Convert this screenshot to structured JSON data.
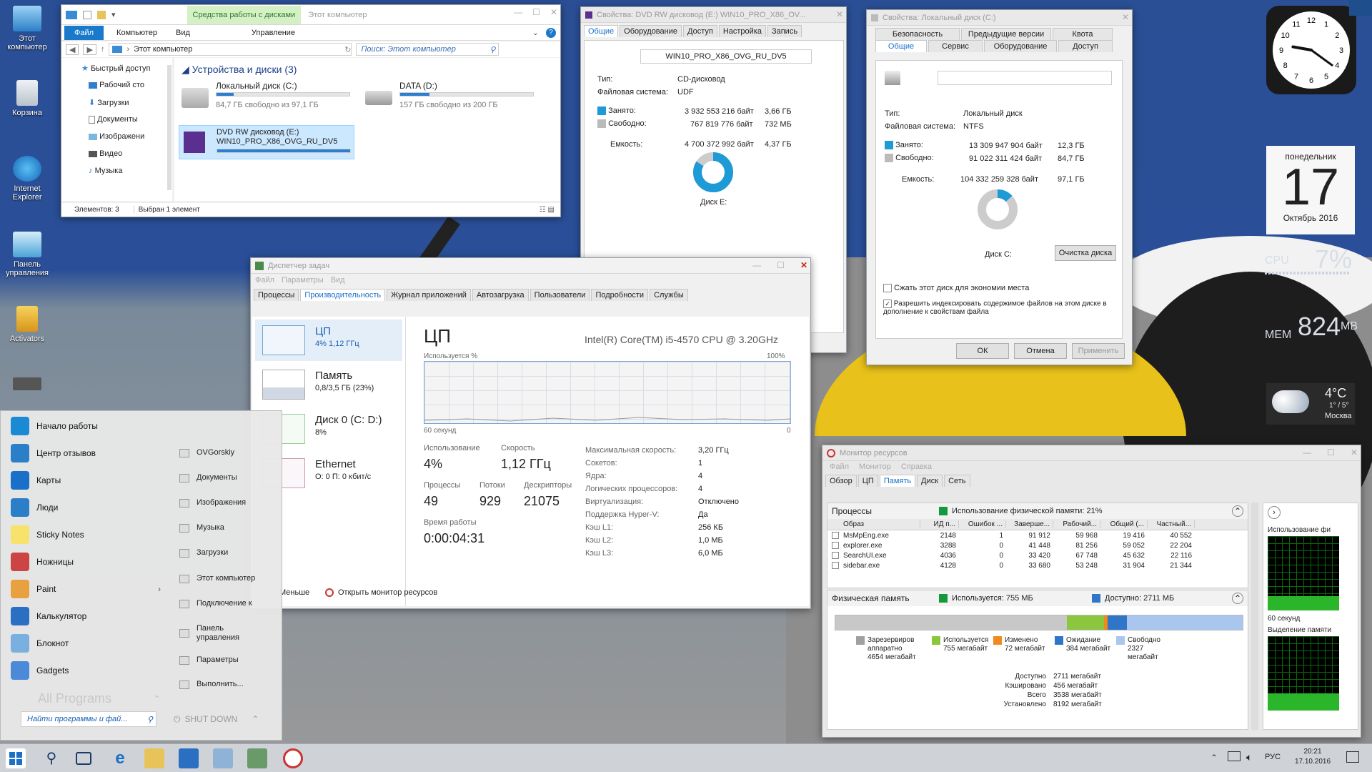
{
  "desktop": {
    "icons": [
      {
        "label": "Этот компьютер"
      },
      {
        "label": "Корзина"
      },
      {
        "label": "Internet Explorer"
      },
      {
        "label": "Панель управления"
      },
      {
        "label": "Activators"
      }
    ]
  },
  "explorer": {
    "context_tab": "Средства работы с дисками",
    "title": "Этот компьютер",
    "ribbon": [
      "Файл",
      "Компьютер",
      "Вид",
      "Управление"
    ],
    "address": "Этот компьютер",
    "search_placeholder": "Поиск: Этот компьютер",
    "group_title": "Устройства и диски (3)",
    "nav": [
      "Быстрый доступ",
      "Рабочий сто",
      "Загрузки",
      "Документы",
      "Изображени",
      "Видео",
      "Музыка"
    ],
    "drives": [
      {
        "name": "Локальный диск (C:)",
        "free": "84,7 ГБ свободно из 97,1 ГБ",
        "used": 0.13
      },
      {
        "name": "DATA (D:)",
        "free": "157 ГБ свободно из 200 ГБ",
        "used": 0.22
      },
      {
        "name": "DVD RW дисковод (E:)",
        "name2": "WIN10_PRO_X86_OVG_RU_DV5",
        "used": 1.0
      }
    ],
    "status_items": "Элементов: 3",
    "status_selected": "Выбран 1 элемент"
  },
  "dvd_props": {
    "title": "Свойства: DVD RW дисковод (E:) WIN10_PRO_X86_OV...",
    "tabs": [
      "Общие",
      "Оборудование",
      "Доступ",
      "Настройка",
      "Запись"
    ],
    "label": "WIN10_PRO_X86_OVG_RU_DV5",
    "type_lbl": "Тип:",
    "type_val": "CD-дисковод",
    "fs_lbl": "Файловая система:",
    "fs_val": "UDF",
    "used_lbl": "Занято:",
    "used_bytes": "3 932 553 216 байт",
    "used_size": "3,66 ГБ",
    "free_lbl": "Свободно:",
    "free_bytes": "767 819 776 байт",
    "free_size": "732 МБ",
    "cap_lbl": "Емкость:",
    "cap_bytes": "4 700 372 992 байт",
    "cap_size": "4,37 ГБ",
    "disk_lbl": "Диск E:",
    "used_fraction": 0.84
  },
  "c_props": {
    "title": "Свойства: Локальный диск (C:)",
    "tabs_row1": [
      "Безопасность",
      "Предыдущие версии",
      "Квота"
    ],
    "tabs_row2": [
      "Общие",
      "Сервис",
      "Оборудование",
      "Доступ"
    ],
    "type_lbl": "Тип:",
    "type_val": "Локальный диск",
    "fs_lbl": "Файловая система:",
    "fs_val": "NTFS",
    "used_lbl": "Занято:",
    "used_bytes": "13 309 947 904 байт",
    "used_size": "12,3 ГБ",
    "free_lbl": "Свободно:",
    "free_bytes": "91 022 311 424 байт",
    "free_size": "84,7 ГБ",
    "cap_lbl": "Емкость:",
    "cap_bytes": "104 332 259 328 байт",
    "cap_size": "97,1 ГБ",
    "disk_lbl": "Диск C:",
    "cleanup": "Очистка диска",
    "compress": "Сжать этот диск для экономии места",
    "index": "Разрешить индексировать содержимое файлов на этом диске в дополнение к свойствам файла",
    "ok": "ОК",
    "cancel": "Отмена",
    "apply": "Применить",
    "used_fraction": 0.13
  },
  "taskmgr": {
    "title": "Диспетчер задач",
    "menu": [
      "Файл",
      "Параметры",
      "Вид"
    ],
    "tabs": [
      "Процессы",
      "Производительность",
      "Журнал приложений",
      "Автозагрузка",
      "Пользователи",
      "Подробности",
      "Службы"
    ],
    "side": [
      {
        "name": "ЦП",
        "sub": "4% 1,12 ГГц"
      },
      {
        "name": "Память",
        "sub": "0,8/3,5 ГБ (23%)"
      },
      {
        "name": "Диск 0 (C: D:)",
        "sub": "8%"
      },
      {
        "name": "Ethernet",
        "sub": "О: 0 П: 0 кбит/с"
      }
    ],
    "heading": "ЦП",
    "cpu_name": "Intel(R) Core(TM) i5-4570 CPU @ 3.20GHz",
    "usage_lbl": "Используется %",
    "pct100": "100%",
    "sec60": "60 секунд",
    "zero": "0",
    "util_lbl": "Использование",
    "util_val": "4%",
    "speed_lbl": "Скорость",
    "speed_val": "1,12 ГГц",
    "proc_lbl": "Процессы",
    "proc_val": "49",
    "thr_lbl": "Потоки",
    "thr_val": "929",
    "hdl_lbl": "Дескрипторы",
    "hdl_val": "21075",
    "up_lbl": "Время работы",
    "up_val": "0:00:04:31",
    "specs": [
      {
        "k": "Максимальная скорость:",
        "v": "3,20 ГГц"
      },
      {
        "k": "Сокетов:",
        "v": "1"
      },
      {
        "k": "Ядра:",
        "v": "4"
      },
      {
        "k": "Логических процессоров:",
        "v": "4"
      },
      {
        "k": "Виртуализация:",
        "v": "Отключено"
      },
      {
        "k": "Поддержка Hyper-V:",
        "v": "Да"
      },
      {
        "k": "Кэш L1:",
        "v": "256 КБ"
      },
      {
        "k": "Кэш L2:",
        "v": "1,0 МБ"
      },
      {
        "k": "Кэш L3:",
        "v": "6,0 МБ"
      }
    ],
    "less": "Меньше",
    "open_rm": "Открыть монитор ресурсов"
  },
  "resmon": {
    "title": "Монитор ресурсов",
    "menu": [
      "Файл",
      "Монитор",
      "Справка"
    ],
    "tabs": [
      "Обзор",
      "ЦП",
      "Память",
      "Диск",
      "Сеть"
    ],
    "proc_hdr": "Процессы",
    "proc_usage": "Использование физической памяти: 21%",
    "cols": [
      "Образ",
      "ИД п...",
      "Ошибок ...",
      "Заверше...",
      "Рабочий...",
      "Общий (...",
      "Частный..."
    ],
    "rows": [
      [
        "MsMpEng.exe",
        "2148",
        "1",
        "91 912",
        "59 968",
        "19 416",
        "40 552"
      ],
      [
        "explorer.exe",
        "3288",
        "0",
        "41 448",
        "81 256",
        "59 052",
        "22 204"
      ],
      [
        "SearchUI.exe",
        "4036",
        "0",
        "33 420",
        "67 748",
        "45 632",
        "22 116"
      ],
      [
        "sidebar.exe",
        "4128",
        "0",
        "33 680",
        "53 248",
        "31 904",
        "21 344"
      ]
    ],
    "phys_hdr": "Физическая память",
    "phys_used": "Используется: 755 МБ",
    "phys_avail": "Доступно: 2711 МБ",
    "legend": [
      {
        "l1": "Зарезервиров",
        "l2": "аппаратно",
        "l3": "4654 мегабайт",
        "color": "#a0a0a0"
      },
      {
        "l1": "Используется",
        "l2": "755 мегабайт",
        "color": "#8cc63e"
      },
      {
        "l1": "Изменено",
        "l2": "72 мегабайт",
        "color": "#f08a1c"
      },
      {
        "l1": "Ожидание",
        "l2": "384 мегабайт",
        "color": "#2f75c8"
      },
      {
        "l1": "Свободно",
        "l2": "2327 мегабайт",
        "color": "#a9c7ee"
      }
    ],
    "summary": [
      {
        "k": "Доступно",
        "v": "2711 мегабайт"
      },
      {
        "k": "Кэшировано",
        "v": "456 мегабайт"
      },
      {
        "k": "Всего",
        "v": "3538 мегабайт"
      },
      {
        "k": "Установлено",
        "v": "8192 мегабайт"
      }
    ],
    "right_title": "Использование фи",
    "right_60": "60 секунд",
    "right_sel": "Выделение памяти"
  },
  "start": {
    "left": [
      "Начало работы",
      "Центр отзывов",
      "Карты",
      "Люди",
      "Sticky Notes",
      "Ножницы",
      "Paint",
      "Калькулятор",
      "Блокнот",
      "Gadgets"
    ],
    "right": [
      "OVGorskiy",
      "Документы",
      "Изображения",
      "Музыка",
      "Загрузки",
      "Этот компьютер",
      "Подключение к",
      "Панель управления",
      "Параметры",
      "Выполнить..."
    ],
    "all": "All Programs",
    "search": "Найти программы и фай...",
    "shutdown": "SHUT DOWN"
  },
  "gadgets": {
    "clock_hours": [
      12,
      1,
      2,
      3,
      4,
      5,
      6,
      7,
      8,
      9,
      10,
      11
    ],
    "day": "понедельник",
    "date": "17",
    "month": "Октябрь 2016",
    "cpu_lbl": "CPU",
    "cpu_val": "7%",
    "mem_lbl": "MEM",
    "mem_val": "824",
    "mem_unit": "MB",
    "temp": "4°C",
    "temp_range": "1° / 5°",
    "city": "Москва"
  },
  "taskbar": {
    "lang": "РУС",
    "time": "20:21",
    "date": "17.10.2016"
  }
}
